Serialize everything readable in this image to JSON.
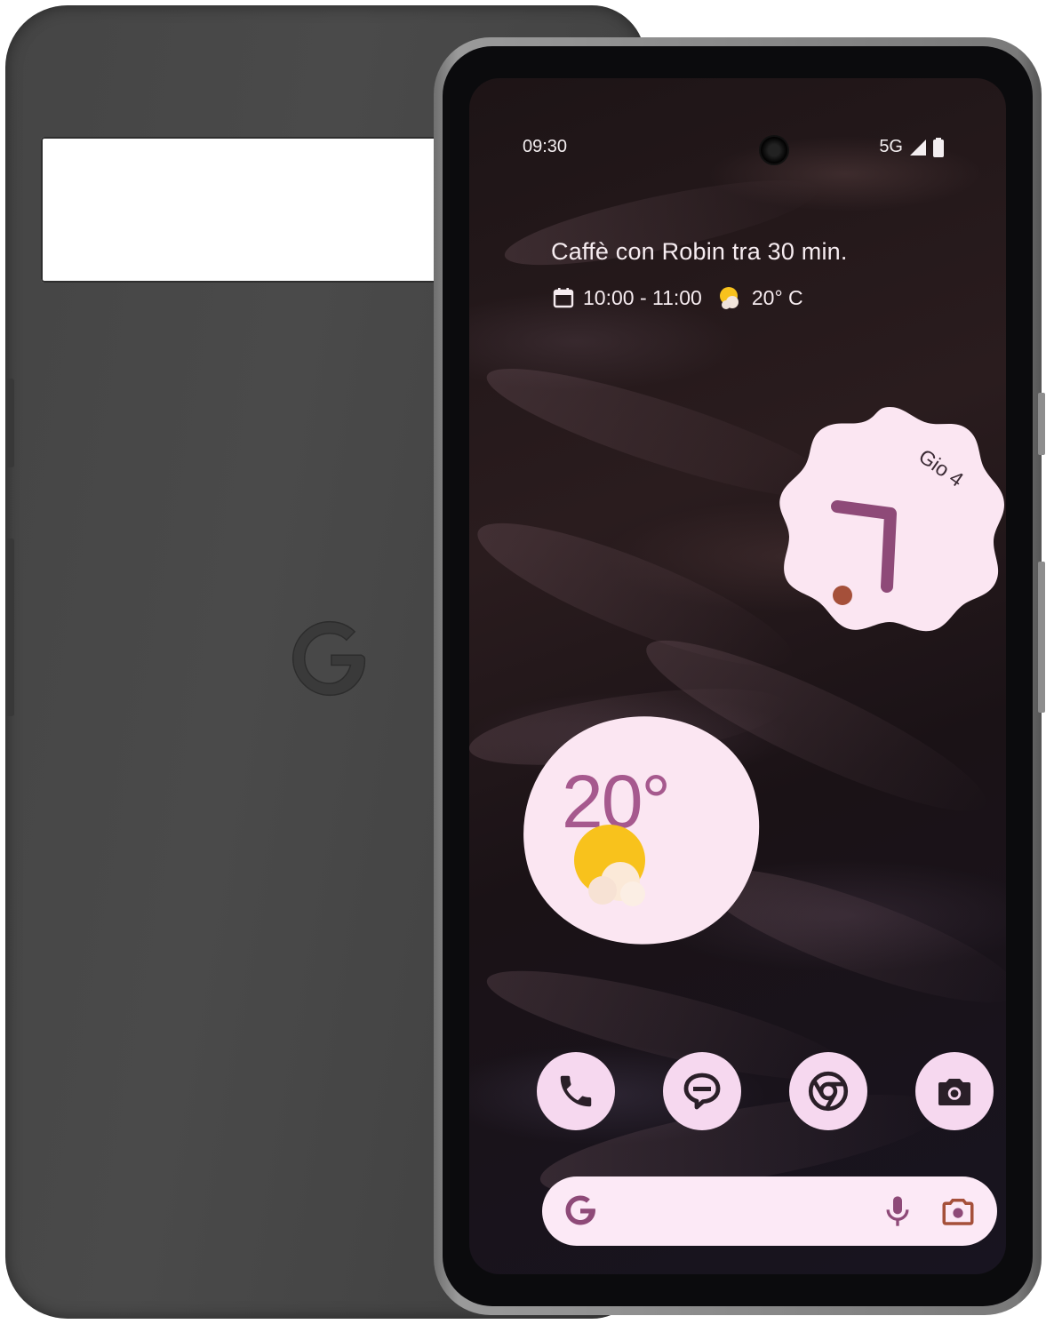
{
  "status_bar": {
    "time": "09:30",
    "network": "5G"
  },
  "at_a_glance": {
    "title": "Caffè con Robin tra 30 min.",
    "event_time": "10:00 - 11:00",
    "temperature": "20° C"
  },
  "clock_widget": {
    "date": "Gio 4"
  },
  "weather_widget": {
    "temperature": "20°"
  },
  "dock": {
    "apps": [
      "phone-icon",
      "messages-icon",
      "chrome-icon",
      "camera-icon"
    ]
  },
  "search_bar": {
    "icons": [
      "google-g-icon",
      "microphone-icon",
      "lens-icon"
    ]
  },
  "colors": {
    "case": "#454545",
    "widget_bg": "#fbe6f2",
    "accent_purple": "#8e4a78",
    "dock_icon_bg": "#f6d8ef",
    "clock_dot": "#a5503a"
  }
}
